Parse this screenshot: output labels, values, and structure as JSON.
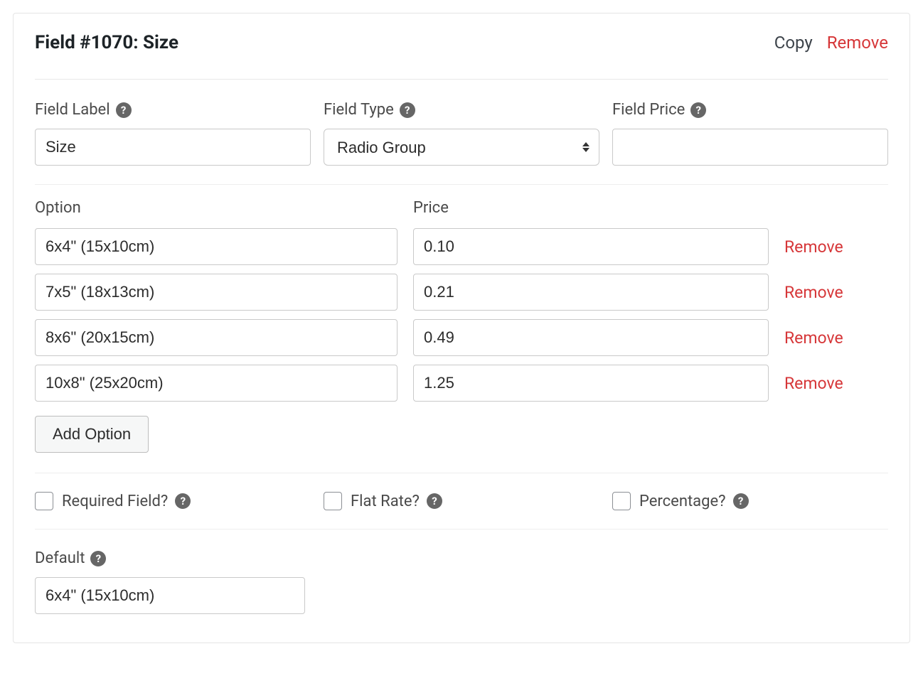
{
  "header": {
    "title": "Field #1070: Size",
    "copy_label": "Copy",
    "remove_label": "Remove"
  },
  "fields": {
    "label": {
      "title": "Field Label",
      "value": "Size"
    },
    "type": {
      "title": "Field Type",
      "value": "Radio Group"
    },
    "price": {
      "title": "Field Price",
      "value": ""
    }
  },
  "options": {
    "option_header": "Option",
    "price_header": "Price",
    "remove_label": "Remove",
    "add_label": "Add Option",
    "rows": [
      {
        "option": "6x4\" (15x10cm)",
        "price": "0.10"
      },
      {
        "option": "7x5\" (18x13cm)",
        "price": "0.21"
      },
      {
        "option": "8x6\" (20x15cm)",
        "price": "0.49"
      },
      {
        "option": "10x8\" (25x20cm)",
        "price": "1.25"
      }
    ]
  },
  "checks": {
    "required": "Required Field?",
    "flat_rate": "Flat Rate?",
    "percentage": "Percentage?"
  },
  "default": {
    "title": "Default",
    "value": "6x4\" (15x10cm)"
  }
}
